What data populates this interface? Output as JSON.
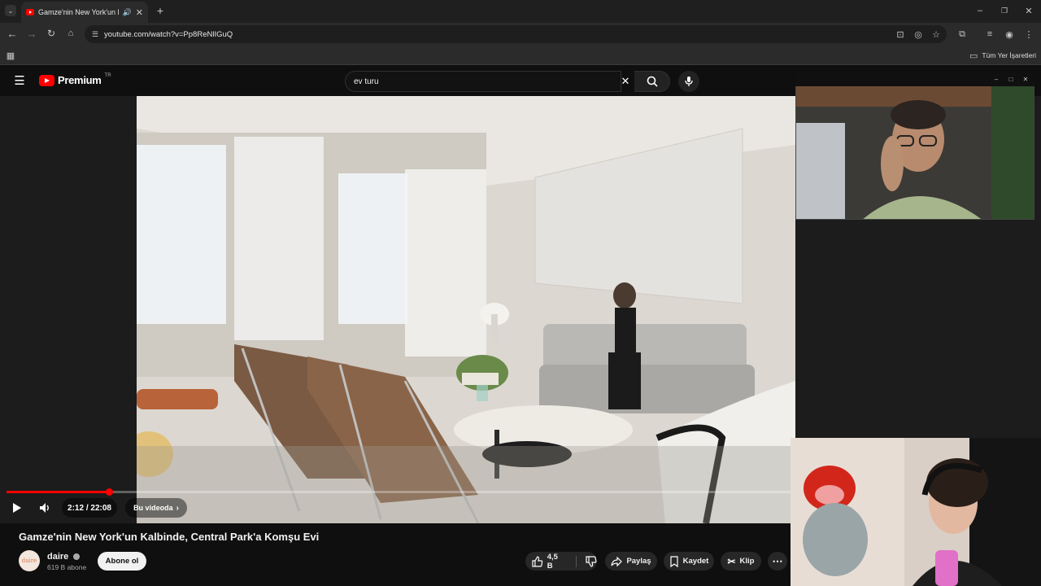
{
  "browser": {
    "tab_title": "Gamze'nin New York'un Kal",
    "url": "youtube.com/watch?v=Pp8ReNlIGuQ",
    "bookmarks_label": "Tüm Yer İşaretleri"
  },
  "youtube": {
    "logo_text": "Premium",
    "logo_badge": "TR",
    "search_value": "ev turu"
  },
  "player": {
    "time": "2:12 / 22:08",
    "chapter_label": "Bu videoda",
    "progress_fraction": 0.131
  },
  "video": {
    "title": "Gamze'nin New York'un Kalbinde, Central Park'a Komşu Evi",
    "channel_name": "daire",
    "channel_avatar_text": "daire",
    "subscribers": "619 B abone",
    "subscribe_label": "Abone ol",
    "likes": "4,5 B",
    "share_label": "Paylaş",
    "save_label": "Kaydet",
    "clip_label": "Klip"
  },
  "colors": {
    "accent": "#ff0000",
    "background": "#0f0f0f"
  }
}
